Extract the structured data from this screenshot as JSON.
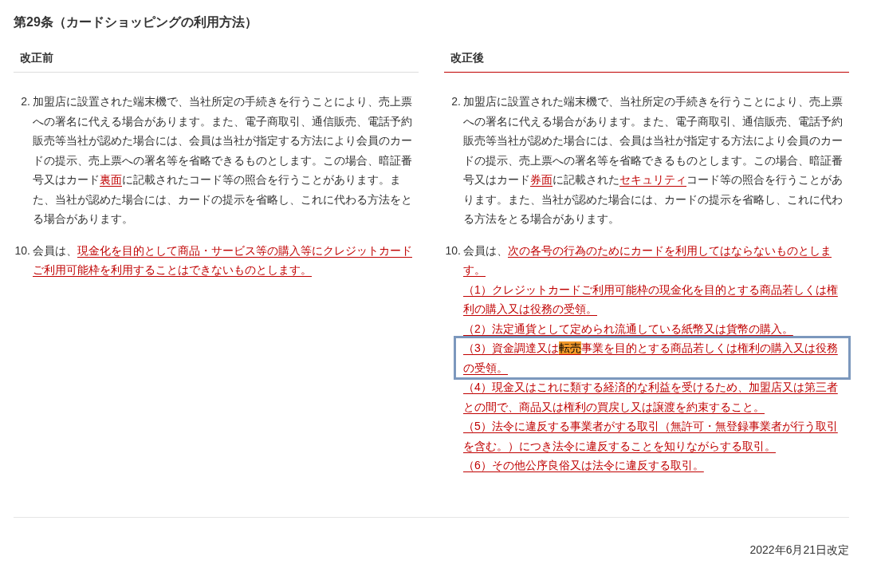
{
  "title": "第29条（カードショッピングの利用方法）",
  "columns": [
    {
      "kind": "before",
      "heading": "改正前",
      "items": [
        {
          "number": "2.",
          "segments": [
            {
              "text": "加盟店に設置された端末機で、当社所定の手続きを行うことにより、売上票への署名に代える場合があります。また、電子商取引、通信販売、電話予約販売等当社が認めた場合には、会員は当社が指定する方法により会員のカードの提示、売上票への署名等を省略できるものとします。この場合、暗証番号又はカード",
              "kind": "plain"
            },
            {
              "text": "裏面",
              "kind": "changed"
            },
            {
              "text": "に記載されたコード等の照合を行うことがあります。また、当社が認めた場合には、カードの提示を省略し、これに代わる方法をとる場合があります。",
              "kind": "plain"
            }
          ]
        },
        {
          "number": "10.",
          "segments": [
            {
              "text": "会員は、",
              "kind": "plain"
            },
            {
              "text": "現金化を目的として商品・サービス等の購入等にクレジットカードご利用可能枠を利用することはできないものとします。",
              "kind": "changed"
            }
          ]
        }
      ]
    },
    {
      "kind": "after",
      "heading": "改正後",
      "items": [
        {
          "number": "2.",
          "segments": [
            {
              "text": "加盟店に設置された端末機で、当社所定の手続きを行うことにより、売上票への署名に代える場合があります。また、電子商取引、通信販売、電話予約販売等当社が認めた場合には、会員は当社が指定する方法により会員のカードの提示、売上票への署名等を省略できるものとします。この場合、暗証番号又はカード",
              "kind": "plain"
            },
            {
              "text": "券面",
              "kind": "changed"
            },
            {
              "text": "に記載された",
              "kind": "plain"
            },
            {
              "text": "セキュリティ",
              "kind": "changed"
            },
            {
              "text": "コード等の照合を行うことがあります。また、当社が認めた場合には、カードの提示を省略し、これに代わる方法をとる場合があります。",
              "kind": "plain"
            }
          ]
        },
        {
          "number": "10.",
          "segments": [
            {
              "text": "会員は、",
              "kind": "plain"
            },
            {
              "text": "次の各号の行為のためにカードを利用してはならないものとします。",
              "kind": "changed"
            }
          ],
          "subitems": [
            {
              "focused": false,
              "segments": [
                {
                  "text": "（1）クレジットカードご利用可能枠の現金化を目的とする商品若しくは権利の購入又は役務の受領。",
                  "kind": "changed"
                }
              ]
            },
            {
              "focused": false,
              "segments": [
                {
                  "text": "（2）法定通貨として定められ流通している紙幣又は貨幣の購入。",
                  "kind": "changed"
                }
              ]
            },
            {
              "focused": true,
              "segments": [
                {
                  "text": "（3）資金調達又は",
                  "kind": "changed"
                },
                {
                  "text": "転売",
                  "kind": "search-hit"
                },
                {
                  "text": "事業を目的とする商品若しくは権利の購入又は役務の受領。",
                  "kind": "changed"
                }
              ]
            },
            {
              "focused": false,
              "segments": [
                {
                  "text": "（4）現金又はこれに類する経済的な利益を受けるため、加盟店又は第三者との間で、商品又は権利の買戻し又は譲渡を約束すること。",
                  "kind": "changed"
                }
              ]
            },
            {
              "focused": false,
              "segments": [
                {
                  "text": "（5）法令に違反する事業者がする取引（無許可・無登録事業者が行う取引を含む。）につき法令に違反することを知りながらする取引。",
                  "kind": "changed"
                }
              ]
            },
            {
              "focused": false,
              "segments": [
                {
                  "text": "（6）その他公序良俗又は法令に違反する取引。",
                  "kind": "changed"
                }
              ]
            }
          ]
        }
      ]
    }
  ],
  "footer": "2022年6月21日改定"
}
